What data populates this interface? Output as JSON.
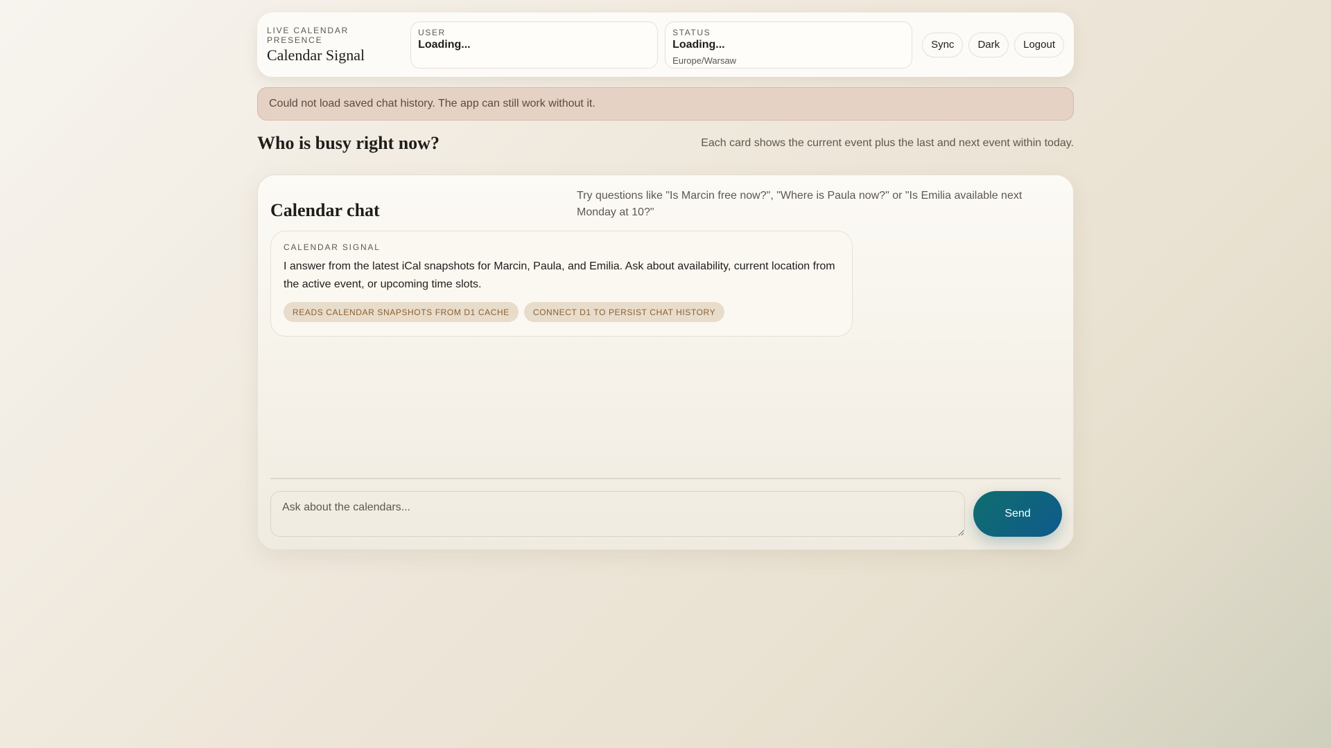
{
  "header": {
    "eyebrow": "LIVE CALENDAR PRESENCE",
    "title": "Calendar Signal",
    "user": {
      "label": "USER",
      "value": "Loading..."
    },
    "status": {
      "label": "STATUS",
      "value": "Loading...",
      "timezone": "Europe/Warsaw"
    },
    "buttons": {
      "sync": "Sync",
      "dark": "Dark",
      "logout": "Logout"
    }
  },
  "alert": "Could not load saved chat history. The app can still work without it.",
  "section": {
    "title": "Who is busy right now?",
    "description": "Each card shows the current event plus the last and next event within today."
  },
  "chat": {
    "title": "Calendar chat",
    "hint": "Try questions like \"Is Marcin free now?\", \"Where is Paula now?\" or \"Is Emilia available next Monday at 10?\"",
    "message": {
      "sender": "CALENDAR SIGNAL",
      "text": "I answer from the latest iCal snapshots for Marcin, Paula, and Emilia. Ask about availability, current location from the active event, or upcoming time slots.",
      "tags": [
        "READS CALENDAR SNAPSHOTS FROM D1 CACHE",
        "CONNECT D1 TO PERSIST CHAT HISTORY"
      ]
    },
    "input_placeholder": "Ask about the calendars...",
    "send": "Send"
  }
}
